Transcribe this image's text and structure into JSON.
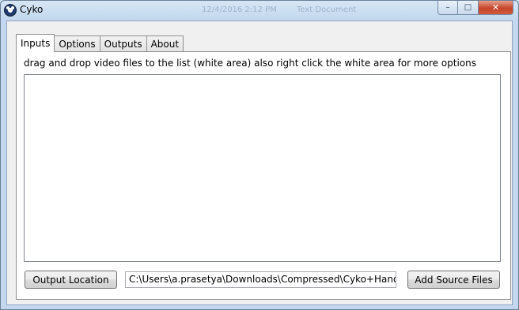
{
  "window": {
    "title": "Cyko",
    "background_titles": [
      "12/4/2016 2:12 PM",
      "Text Document"
    ],
    "caption_buttons": {
      "minimize": "–",
      "maximize": "□",
      "close": "✕"
    }
  },
  "tabs": [
    {
      "label": "Inputs",
      "active": true
    },
    {
      "label": "Options",
      "active": false
    },
    {
      "label": "Outputs",
      "active": false
    },
    {
      "label": "About",
      "active": false
    }
  ],
  "inputs_panel": {
    "instruction": "drag and drop video files to the list (white area) also right click the white area for more options",
    "output_location_label": "Output Location",
    "output_path_value": "C:\\Users\\a.prasetya\\Downloads\\Compressed\\Cyko+Handbrake",
    "add_source_label": "Add Source Files"
  },
  "icons": {
    "app": "cyko-app-icon"
  }
}
